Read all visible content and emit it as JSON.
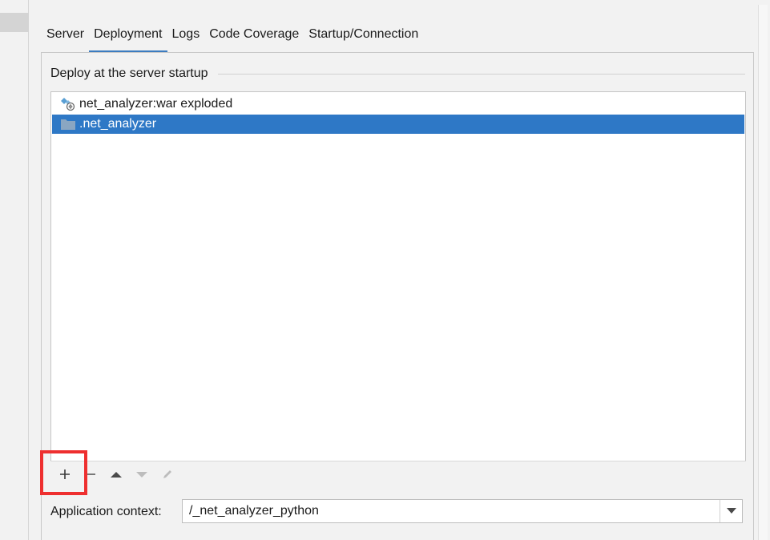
{
  "tabs": [
    {
      "label": "Server"
    },
    {
      "label": "Deployment"
    },
    {
      "label": "Logs"
    },
    {
      "label": "Code Coverage"
    },
    {
      "label": "Startup/Connection"
    }
  ],
  "active_tab": "Deployment",
  "deploy_group": {
    "title": "Deploy at the server startup",
    "items": [
      {
        "label": "net_analyzer:war exploded",
        "icon": "war-exploded-icon",
        "selected": false
      },
      {
        "label": ".net_analyzer",
        "icon": "folder-icon",
        "selected": true
      }
    ]
  },
  "toolbar": {
    "add_icon": "plus-icon",
    "remove_icon": "minus-icon",
    "up_icon": "arrow-up-icon",
    "down_icon": "arrow-down-icon",
    "edit_icon": "pencil-icon"
  },
  "application_context": {
    "label": "Application context:",
    "value": "/_net_analyzer_python"
  },
  "colors": {
    "selection": "#2e78c6",
    "tab_underline": "#3c7cc0",
    "highlight": "#ee2f2f"
  }
}
